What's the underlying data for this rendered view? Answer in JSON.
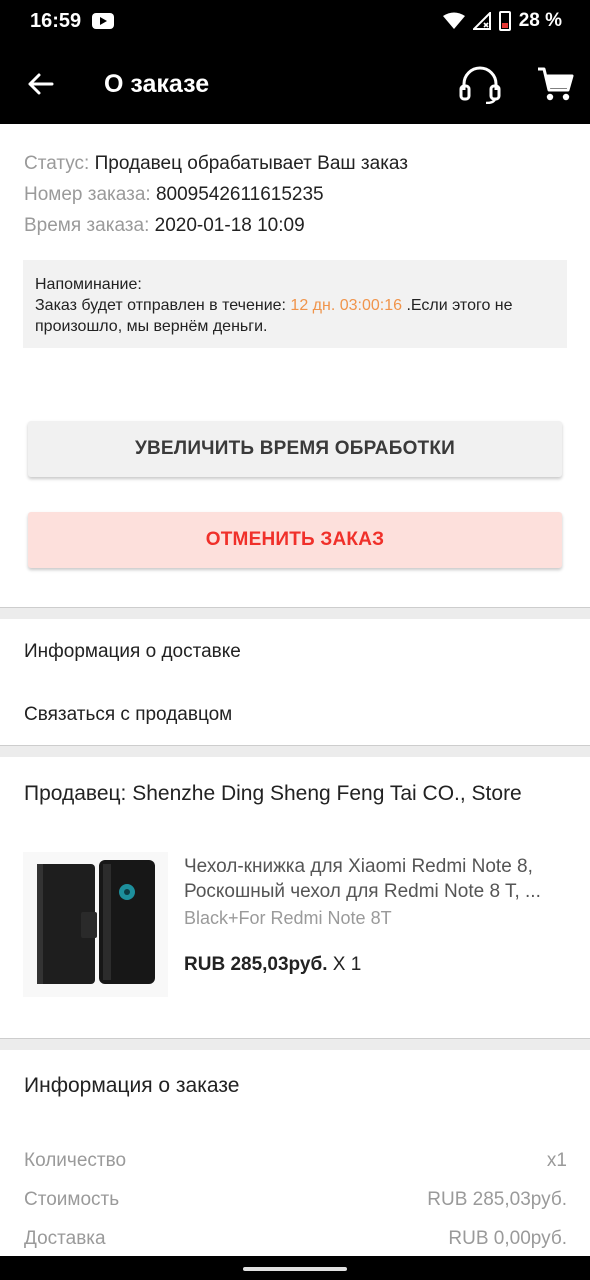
{
  "status_bar": {
    "time": "16:59",
    "battery": "28 %"
  },
  "app_bar": {
    "title": "О заказе"
  },
  "order": {
    "status_label": "Статус:",
    "status_value": "Продавец обрабатывает Ваш заказ",
    "number_label": "Номер заказа:",
    "number_value": "8009542611615235",
    "time_label": "Время заказа:",
    "time_value": "2020-01-18 10:09"
  },
  "reminder": {
    "title": "Напоминание:",
    "text_before": "Заказ будет отправлен в течение: ",
    "countdown": "12 дн. 03:00:16",
    "text_after": " .Если этого не произошло, мы вернём деньги."
  },
  "buttons": {
    "extend": "УВЕЛИЧИТЬ ВРЕМЯ ОБРАБОТКИ",
    "cancel": "ОТМЕНИТЬ ЗАКАЗ"
  },
  "links": {
    "delivery": "Информация о доставке",
    "contact": "Связаться с продавцом"
  },
  "seller": {
    "label": "Продавец: Shenzhe Ding Sheng Feng Tai CO., Store"
  },
  "product": {
    "title": "Чехол-книжка для Xiaomi Redmi Note 8, Роскошный чехол для Redmi Note 8 T, ...",
    "variant": "Black+For Redmi Note 8T",
    "price": "RUB 285,03руб.",
    "quantity": " X 1"
  },
  "order_info": {
    "heading": "Информация о заказе",
    "rows": [
      {
        "label": "Количество",
        "value": "x1"
      },
      {
        "label": "Стоимость",
        "value": "RUB 285,03руб."
      },
      {
        "label": "Доставка",
        "value": "RUB 0,00руб."
      }
    ]
  },
  "colors": {
    "accent_orange": "#f0944b",
    "cancel_red": "#f0302a",
    "cancel_bg": "#fde0dc"
  }
}
